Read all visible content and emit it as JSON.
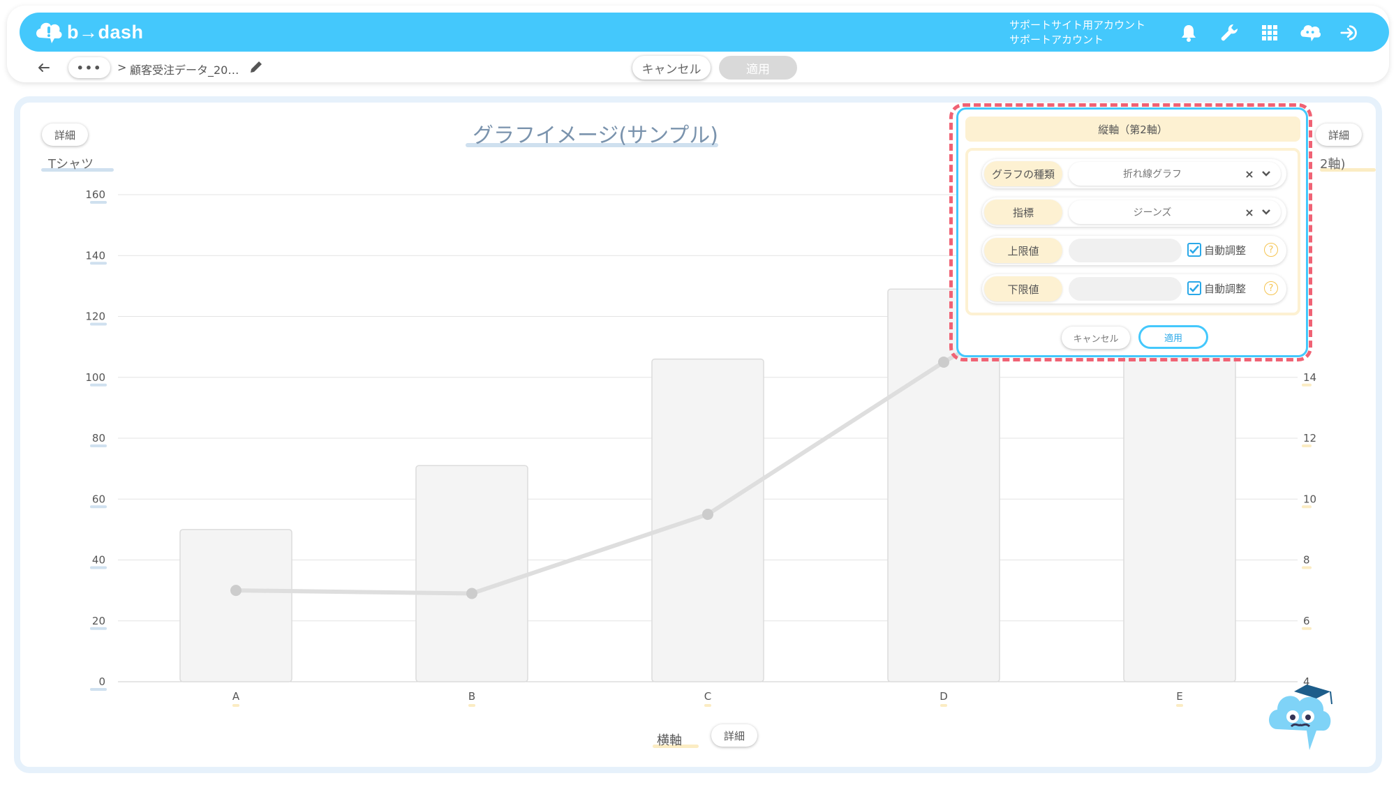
{
  "header": {
    "logo_text": "b→dash",
    "account_line1": "サポートサイト用アカウント",
    "account_line2": "サポートアカウント",
    "icons": [
      "bell-icon",
      "wrench-icon",
      "grid-icon",
      "chat-icon",
      "logout-icon"
    ]
  },
  "subbar": {
    "more_label": "•••",
    "separator": ">",
    "breadcrumb_title": "顧客受注データ_20…",
    "cancel_label": "キャンセル",
    "apply_label": "適用"
  },
  "chart_panel": {
    "detail_left_label": "詳細",
    "detail_right_label": "詳細",
    "x_axis_detail_label": "詳細",
    "title": "グラフイメージ(サンプル)",
    "y_axis_label": "Tシャツ",
    "y2_axis_label_partial": "2軸)",
    "x_axis_label": "横軸"
  },
  "chart_data": {
    "type": "bar",
    "title": "グラフイメージ(サンプル)",
    "xlabel": "横軸",
    "ylabel": "Tシャツ",
    "categories": [
      "A",
      "B",
      "C",
      "D",
      "E"
    ],
    "ylim": [
      0,
      160
    ],
    "yticks": [
      0,
      20,
      40,
      60,
      80,
      100,
      120,
      140,
      160
    ],
    "y2lim": [
      4,
      20
    ],
    "y2ticks": [
      4,
      6,
      8,
      10,
      12,
      14
    ],
    "series": [
      {
        "name": "Tシャツ",
        "type": "bar",
        "axis": "left",
        "values": [
          50,
          71,
          106,
          129,
          120
        ]
      },
      {
        "name": "ジーンズ",
        "type": "line",
        "axis": "right",
        "values": [
          7.0,
          6.9,
          9.5,
          14.5,
          null
        ]
      }
    ],
    "colors": {
      "bar_fill": "#f4f4f4",
      "bar_stroke": "#dcdcdc",
      "line": "#dedede",
      "marker": "#cccccc"
    }
  },
  "popup": {
    "title": "縦軸（第2軸）",
    "rows": [
      {
        "label": "グラフの種類",
        "value": "折れ線グラフ",
        "clear": "×"
      },
      {
        "label": "指標",
        "value": "ジーンズ",
        "clear": "×"
      }
    ],
    "limits": [
      {
        "label": "上限値",
        "value": "",
        "auto_label": "自動調整",
        "auto_checked": true,
        "help": "?"
      },
      {
        "label": "下限値",
        "value": "",
        "auto_label": "自動調整",
        "auto_checked": true,
        "help": "?"
      }
    ],
    "cancel_label": "キャンセル",
    "apply_label": "適用"
  },
  "colors": {
    "brand": "#44c8fc",
    "highlight": "#f06274",
    "label_bg": "#fdf1d2"
  }
}
